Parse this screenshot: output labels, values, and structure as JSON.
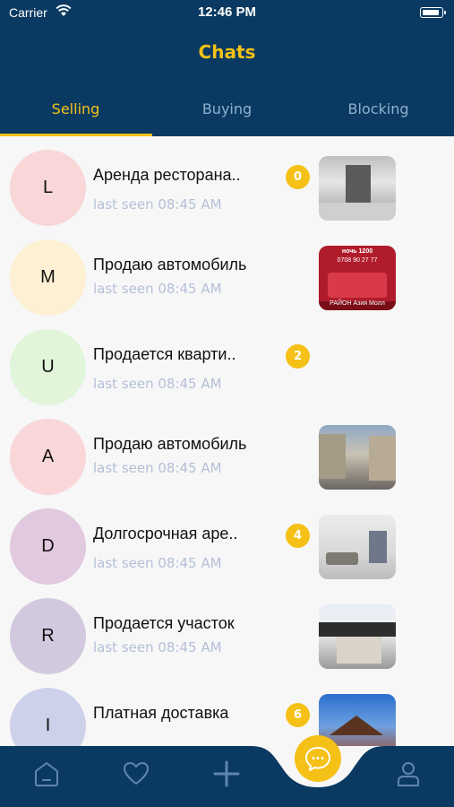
{
  "status_bar": {
    "carrier": "Carrier",
    "time": "12:46 PM"
  },
  "header": {
    "title": "Chats"
  },
  "tabs": [
    {
      "label": "Selling",
      "active": true
    },
    {
      "label": "Buying",
      "active": false
    },
    {
      "label": "Blocking",
      "active": false
    }
  ],
  "chats": [
    {
      "initial": "L",
      "title": "Аренда ресторана..",
      "subtitle": "last seen 08:45 AM",
      "badge": "0",
      "avatar_color": "#f9d6d8",
      "thumb": "room"
    },
    {
      "initial": "M",
      "title": "Продаю автомобиль",
      "subtitle": "last seen 08:45 AM",
      "badge": "",
      "avatar_color": "#fdf0d3",
      "thumb": "bed",
      "thumb_text": [
        "ночь 1200",
        "0708 90 27 77",
        "РАЙОН Азия Молл"
      ]
    },
    {
      "initial": "U",
      "title": "Продается кварти..",
      "subtitle": "last seen 08:45 AM",
      "badge": "2",
      "avatar_color": "#e0f5da",
      "thumb": ""
    },
    {
      "initial": "A",
      "title": "Продаю автомобиль",
      "subtitle": "last seen 08:45 AM",
      "badge": "",
      "avatar_color": "#f9d6d8",
      "thumb": "street"
    },
    {
      "initial": "D",
      "title": "Долгосрочная аре..",
      "subtitle": "last seen 08:45 AM",
      "badge": "4",
      "avatar_color": "#e1c9df",
      "thumb": "living"
    },
    {
      "initial": "R",
      "title": "Продается участок",
      "subtitle": "last seen 08:45 AM",
      "badge": "",
      "avatar_color": "#d2c9df",
      "thumb": "building"
    },
    {
      "initial": "I",
      "title": "Платная доставка",
      "subtitle": "",
      "badge": "6",
      "avatar_color": "#cdd1ea",
      "thumb": "house"
    }
  ],
  "bottom_nav": {
    "items": [
      "home-icon",
      "heart-icon",
      "plus-icon",
      "chat-icon",
      "profile-icon"
    ],
    "active": "chat-icon"
  },
  "colors": {
    "primary": "#0a3a62",
    "accent": "#f5c116",
    "background": "#f7f7f7",
    "subtitle": "#b4bfd8",
    "tab_inactive": "#8fb0cc"
  }
}
